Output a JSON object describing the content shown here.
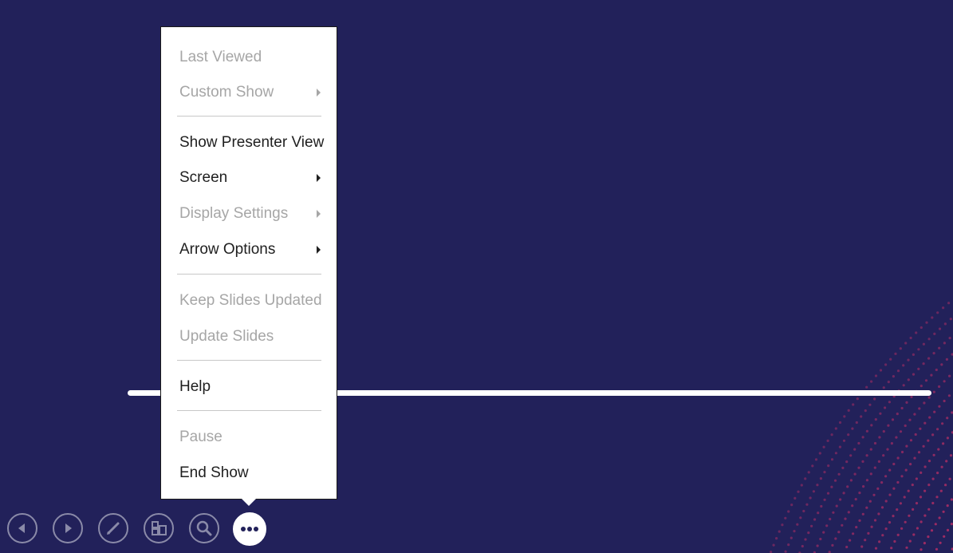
{
  "menu": {
    "items": [
      {
        "label": "Last Viewed",
        "enabled": false,
        "submenu": false
      },
      {
        "label": "Custom Show",
        "enabled": false,
        "submenu": true
      },
      {
        "label": "Show Presenter View",
        "enabled": true,
        "submenu": false
      },
      {
        "label": "Screen",
        "enabled": true,
        "submenu": true
      },
      {
        "label": "Display Settings",
        "enabled": false,
        "submenu": true
      },
      {
        "label": "Arrow Options",
        "enabled": true,
        "submenu": true
      },
      {
        "label": "Keep Slides Updated",
        "enabled": false,
        "submenu": false
      },
      {
        "label": "Update Slides",
        "enabled": false,
        "submenu": false
      },
      {
        "label": "Help",
        "enabled": true,
        "submenu": false
      },
      {
        "label": "Pause",
        "enabled": false,
        "submenu": false
      },
      {
        "label": "End Show",
        "enabled": true,
        "submenu": false
      }
    ]
  },
  "controls": [
    {
      "icon": "previous-icon"
    },
    {
      "icon": "next-icon"
    },
    {
      "icon": "pen-icon"
    },
    {
      "icon": "see-all-slides-icon"
    },
    {
      "icon": "zoom-icon"
    },
    {
      "icon": "more-options-icon",
      "active": true
    }
  ],
  "colors": {
    "background": "#22215a",
    "dot_pattern": "#e8336a",
    "menu_text": "#1f1f1f",
    "menu_disabled": "#a6a6a6"
  }
}
